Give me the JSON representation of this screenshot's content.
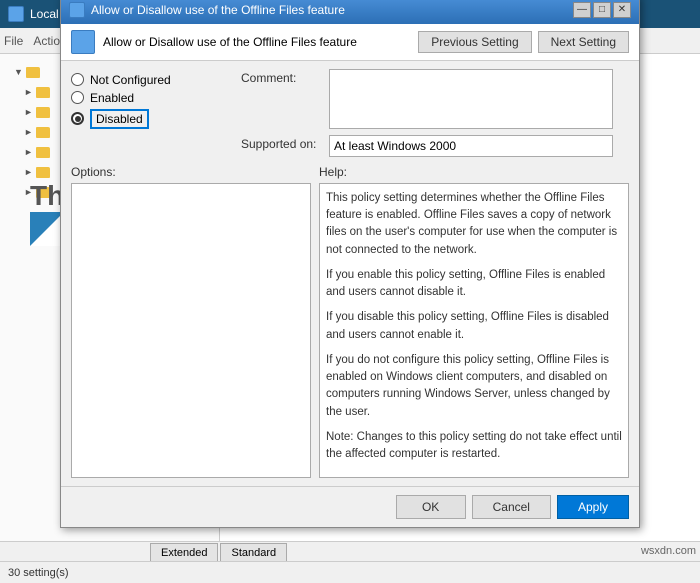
{
  "app": {
    "title": "Local Group Policy Editor",
    "dialog_title": "Allow or Disallow use of the Offline Files feature",
    "header_title": "Allow or Disallow use of the Offline Files feature"
  },
  "dialog": {
    "prev_btn": "Previous Setting",
    "next_btn": "Next Setting",
    "radio_not_configured": "Not Configured",
    "radio_enabled": "Enabled",
    "radio_disabled": "Disabled",
    "comment_label": "Comment:",
    "supported_label": "Supported on:",
    "supported_value": "At least Windows 2000",
    "options_label": "Options:",
    "help_label": "Help:",
    "help_text_1": "This policy setting determines whether the Offline Files feature is enabled. Offline Files saves a copy of network files on the user's computer for use when the computer is not connected to the network.",
    "help_text_2": "If you enable this policy setting, Offline Files is enabled and users cannot disable it.",
    "help_text_3": "If you disable this policy setting, Offline Files is disabled and users cannot enable it.",
    "help_text_4": "If you do not configure this policy setting, Offline Files is enabled on Windows client computers, and disabled on computers running Windows Server, unless changed by the user.",
    "help_text_5": "Note: Changes to this policy setting do not take effect until the affected computer is restarted.",
    "ok_label": "OK",
    "cancel_label": "Cancel",
    "apply_label": "Apply"
  },
  "statusbar": {
    "text": "30 setting(s)"
  },
  "tabs": {
    "extended": "Extended",
    "standard": "Standard"
  },
  "title_buttons": {
    "minimize": "—",
    "maximize": "□",
    "close": "✕"
  },
  "watermark": {
    "wsxdn": "wsxdn.com"
  }
}
